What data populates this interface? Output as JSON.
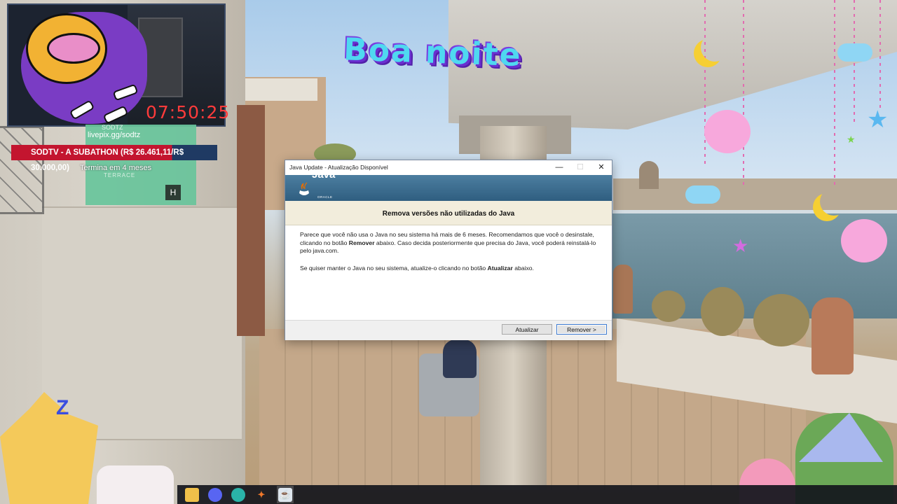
{
  "stream": {
    "timer": "07:50:25",
    "handle_partial": "SODTZ",
    "livepix": "livepix.gg/sodtz",
    "subathon_banner": "SODTV - A SUBATHON (R$ 26.461,11/R$ 30.000,00)",
    "ends_in": "Termina em 4 meses",
    "terrace_sign": "TERRACE",
    "hsign": "H",
    "greeting": "Boa noite"
  },
  "dialog": {
    "title": "Java Update - Atualização Disponível",
    "minimize_glyph": "—",
    "maximize_glyph": "☐",
    "close_glyph": "✕",
    "logo_text": "Java",
    "logo_sub": "ORACLE",
    "headline": "Remova versões não utilizadas do Java",
    "paragraph1_before": "Parece que você não usa o Java no seu sistema há mais de 6 meses. Recomendamos que você o desinstale, clicando no botão ",
    "paragraph1_bold": "Remover",
    "paragraph1_after": " abaixo. Caso decida posteriormente que precisa do Java, você poderá reinstalá-lo pelo java.com.",
    "paragraph2_before": "Se quiser manter o Java no seu sistema, atualize-o clicando no botão ",
    "paragraph2_bold": "Atualizar",
    "paragraph2_after": " abaixo.",
    "update_button": "Atualizar",
    "remove_button": "Remover >"
  },
  "taskbar": {
    "icons": [
      "file-explorer-icon",
      "discord-icon",
      "edge-icon",
      "app-orange-icon",
      "java-update-icon"
    ]
  },
  "colors": {
    "timer": "#ff3b3b",
    "banner_red": "#c3152f",
    "java_header": "#2f5e80",
    "subhead_bg": "#f2eddc"
  }
}
